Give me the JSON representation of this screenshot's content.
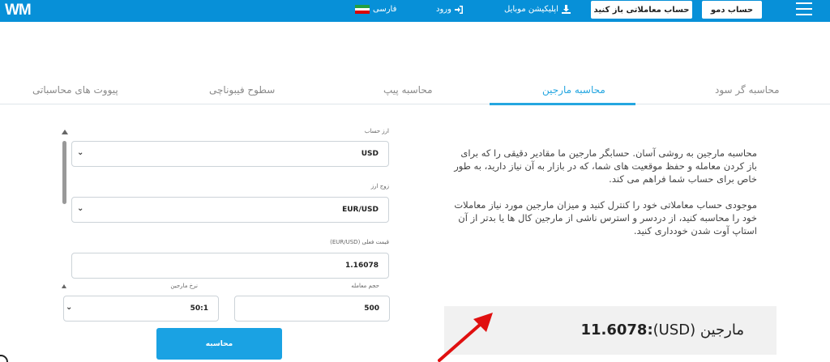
{
  "header": {
    "logo": "WM",
    "language": "فارسی",
    "login": "ورود",
    "mobile_app": "اپلیکیشن موبایل",
    "open_account": "حساب معاملاتی باز کنید",
    "demo_account": "حساب دمو"
  },
  "tabs": [
    {
      "label": "محاسبه گر سود",
      "active": false
    },
    {
      "label": "محاسبه مارجین",
      "active": true
    },
    {
      "label": "محاسبه پیپ",
      "active": false
    },
    {
      "label": "سطوح فیبوناچی",
      "active": false
    },
    {
      "label": "پیووت های محاسباتی",
      "active": false
    }
  ],
  "description": {
    "p1": "محاسبه مارجین به روشی آسان. حسابگر مارجین ما مقادیر دقیقی را که برای باز کردن معامله و حفظ موقعیت های شما، که در بازار به آن نیاز دارید، به طور خاص برای حساب شما فراهم می کند.",
    "p2": "موجودی حساب معاملاتی خود را کنترل کنید و میزان مارجین مورد نیاز معاملات خود را محاسبه کنید، از دردسر و استرس ناشی از مارجین کال ها یا بدتر از آن استاپ آوت شدن خودداری کنید."
  },
  "form": {
    "account_currency_label": "ارز حساب",
    "account_currency_value": "USD",
    "currency_pair_label": "زوج ارز",
    "currency_pair_value": "EUR/USD",
    "current_price_label": "قیمت فعلی (EUR/USD)",
    "current_price_value": "1.16078",
    "leverage_label": "نرخ مارجین",
    "leverage_value": "50:1",
    "volume_label": "حجم معامله",
    "volume_value": "500",
    "calculate_button": "محاسبه"
  },
  "result": {
    "label": "مارجین",
    "currency": "(USD)",
    "value": "11.6078"
  },
  "colors": {
    "brand": "#0790d8",
    "accent": "#25a6e0",
    "button": "#1aa2e3",
    "arrow": "#e01010"
  },
  "icons": [
    "menu-icon",
    "download-icon",
    "login-icon",
    "iran-flag-icon",
    "chevron-down-icon",
    "red-arrow-icon"
  ]
}
